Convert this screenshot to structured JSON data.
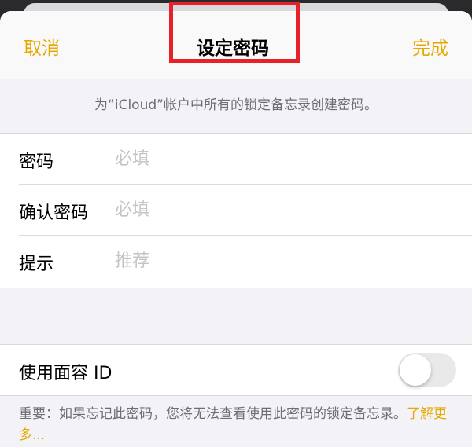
{
  "navbar": {
    "cancel_label": "取消",
    "title": "设定密码",
    "done_label": "完成"
  },
  "section": {
    "description": "为“iCloud”帐户中所有的锁定备忘录创建密码。"
  },
  "form": {
    "rows": [
      {
        "label": "密码",
        "placeholder": "必填",
        "value": ""
      },
      {
        "label": "确认密码",
        "placeholder": "必填",
        "value": ""
      },
      {
        "label": "提示",
        "placeholder": "推荐",
        "value": ""
      }
    ]
  },
  "faceid": {
    "label": "使用面容 ID",
    "enabled": false
  },
  "footer": {
    "note": "重要：如果忘记此密码，您将无法查看使用此密码的锁定备忘录。",
    "learn_more": "了解更多..."
  },
  "colors": {
    "accent": "#e5a800",
    "highlight": "#e8202a",
    "background": "#f2f2f7"
  }
}
